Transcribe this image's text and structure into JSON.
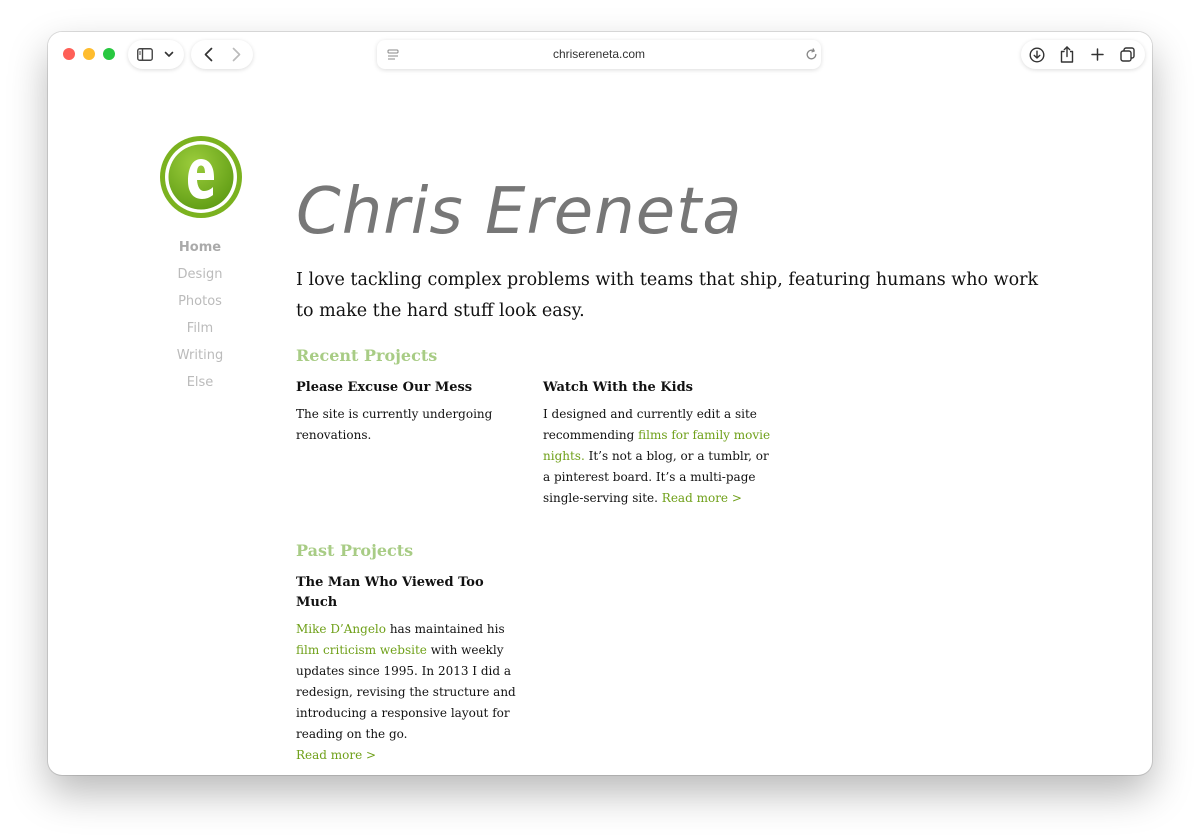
{
  "browser": {
    "url": "chrisereneta.com"
  },
  "site": {
    "title": "Chris Ereneta",
    "logo_letter": "e",
    "nav": [
      {
        "label": "Home"
      },
      {
        "label": "Design"
      },
      {
        "label": "Photos"
      },
      {
        "label": "Film"
      },
      {
        "label": "Writing"
      },
      {
        "label": "Else"
      }
    ],
    "intro": "I love tackling complex problems with teams that ship, featuring humans who work to make the hard stuff look easy."
  },
  "recent": {
    "heading": "Recent Projects",
    "project1": {
      "title": "Please Excuse Our Mess",
      "text": "The site is currently undergoing renovations."
    },
    "project2": {
      "title": "Watch With the Kids",
      "text_a": "I designed and currently edit a site recommending ",
      "link_a": "films for family movie nights.",
      "text_b": " It’s not a blog, or a tumblr, or a pinterest board. It’s a multi-page single-serving site. ",
      "read_more": "Read more >"
    }
  },
  "past": {
    "heading": "Past Projects",
    "project1": {
      "title": "The Man Who Viewed Too Much",
      "link_a": "Mike D’Angelo",
      "text_a": " has maintained his ",
      "link_b": "film criticism website",
      "text_b": " with weekly updates since 1995. In 2013 I did a redesign, revising the structure and introducing a responsive layout for reading on the go.",
      "read_more": "Read more >"
    }
  },
  "colors": {
    "accent_link": "#6fa019",
    "section_heading": "#a8cc85",
    "logo_green": "#7bb21f"
  }
}
